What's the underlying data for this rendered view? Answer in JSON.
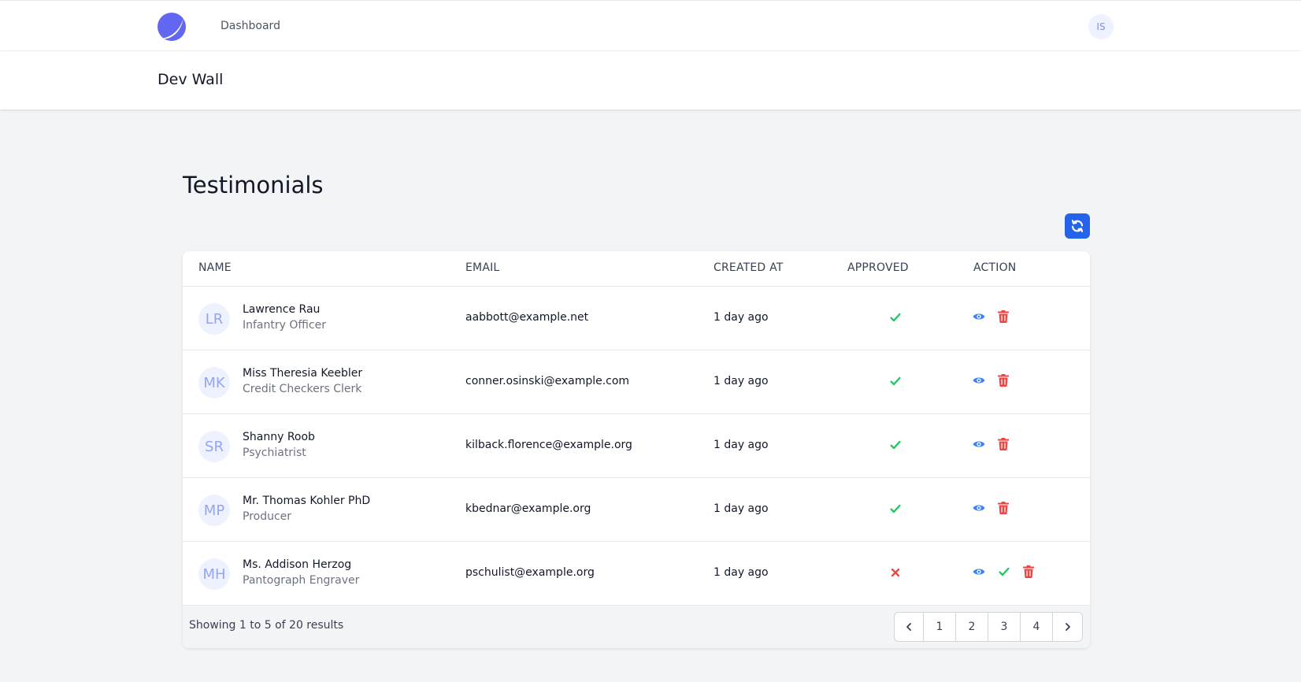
{
  "nav": {
    "logo_icon": "moon-logo-icon",
    "dashboard_label": "Dashboard",
    "user_initials": "IS"
  },
  "header": {
    "title": "Dev Wall"
  },
  "main": {
    "title": "Testimonials",
    "refresh_icon": "refresh-icon",
    "columns": {
      "name": "NAME",
      "email": "EMAIL",
      "created_at": "CREATED AT",
      "approved": "APPROVED",
      "action": "ACTION"
    },
    "rows": [
      {
        "initials": "LR",
        "name": "Lawrence Rau",
        "title": "Infantry Officer",
        "email": "aabbott@example.net",
        "created": "1 day ago",
        "approved": true
      },
      {
        "initials": "MK",
        "name": "Miss Theresia Keebler",
        "title": "Credit Checkers Clerk",
        "email": "conner.osinski@example.com",
        "created": "1 day ago",
        "approved": true
      },
      {
        "initials": "SR",
        "name": "Shanny Roob",
        "title": "Psychiatrist",
        "email": "kilback.florence@example.org",
        "created": "1 day ago",
        "approved": true
      },
      {
        "initials": "MP",
        "name": "Mr. Thomas Kohler PhD",
        "title": "Producer",
        "email": "kbednar@example.org",
        "created": "1 day ago",
        "approved": true
      },
      {
        "initials": "MH",
        "name": "Ms. Addison Herzog",
        "title": "Pantograph Engraver",
        "email": "pschulist@example.org",
        "created": "1 day ago",
        "approved": false
      }
    ],
    "footer": {
      "summary": "Showing 1 to 5 of 20 results",
      "pages": [
        "1",
        "2",
        "3",
        "4"
      ]
    }
  },
  "colors": {
    "accent": "#2563eb",
    "view": "#3b82f6",
    "approve": "#22c55e",
    "delete": "#ef4444"
  }
}
